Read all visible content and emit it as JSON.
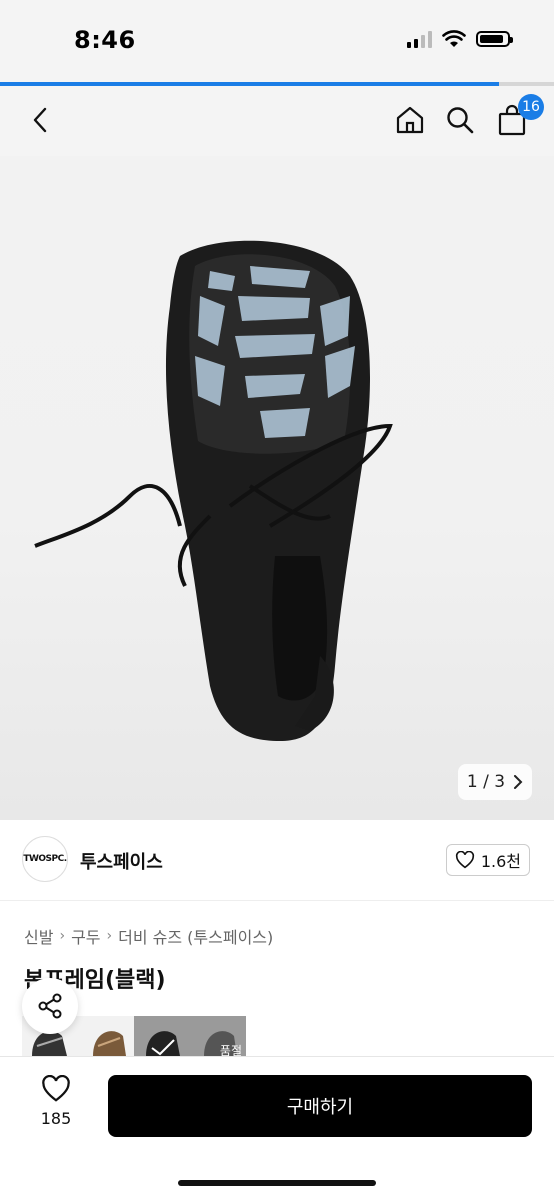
{
  "status_bar": {
    "time": "8:46",
    "battery_level": 0.9,
    "signal_bars": 2
  },
  "page_progress": 0.9,
  "header": {
    "icons": [
      "chevron-left-icon",
      "home-icon",
      "search-icon",
      "shopping-bag-icon"
    ],
    "cart_count": "16"
  },
  "gallery": {
    "pager_text": "1 / 3",
    "current": 1,
    "total": 3
  },
  "brand": {
    "logo_text": "TWOSPC.",
    "name": "투스페이스",
    "likes": "1.6천"
  },
  "breadcrumb": [
    "신발",
    "구두",
    "더비 슈즈 (투스페이스)"
  ],
  "product": {
    "title": "본프레임(블랙)"
  },
  "thumbnails": [
    {
      "label": "",
      "sold_out": false
    },
    {
      "label": "",
      "sold_out": false
    },
    {
      "label": "",
      "sold_out": false,
      "selected": true
    },
    {
      "label": "품절",
      "sold_out": true
    }
  ],
  "bottom_bar": {
    "wish_count": "185",
    "buy_label": "구매하기"
  },
  "colors": {
    "accent": "#1a7de6",
    "buy_button": "#000000"
  }
}
